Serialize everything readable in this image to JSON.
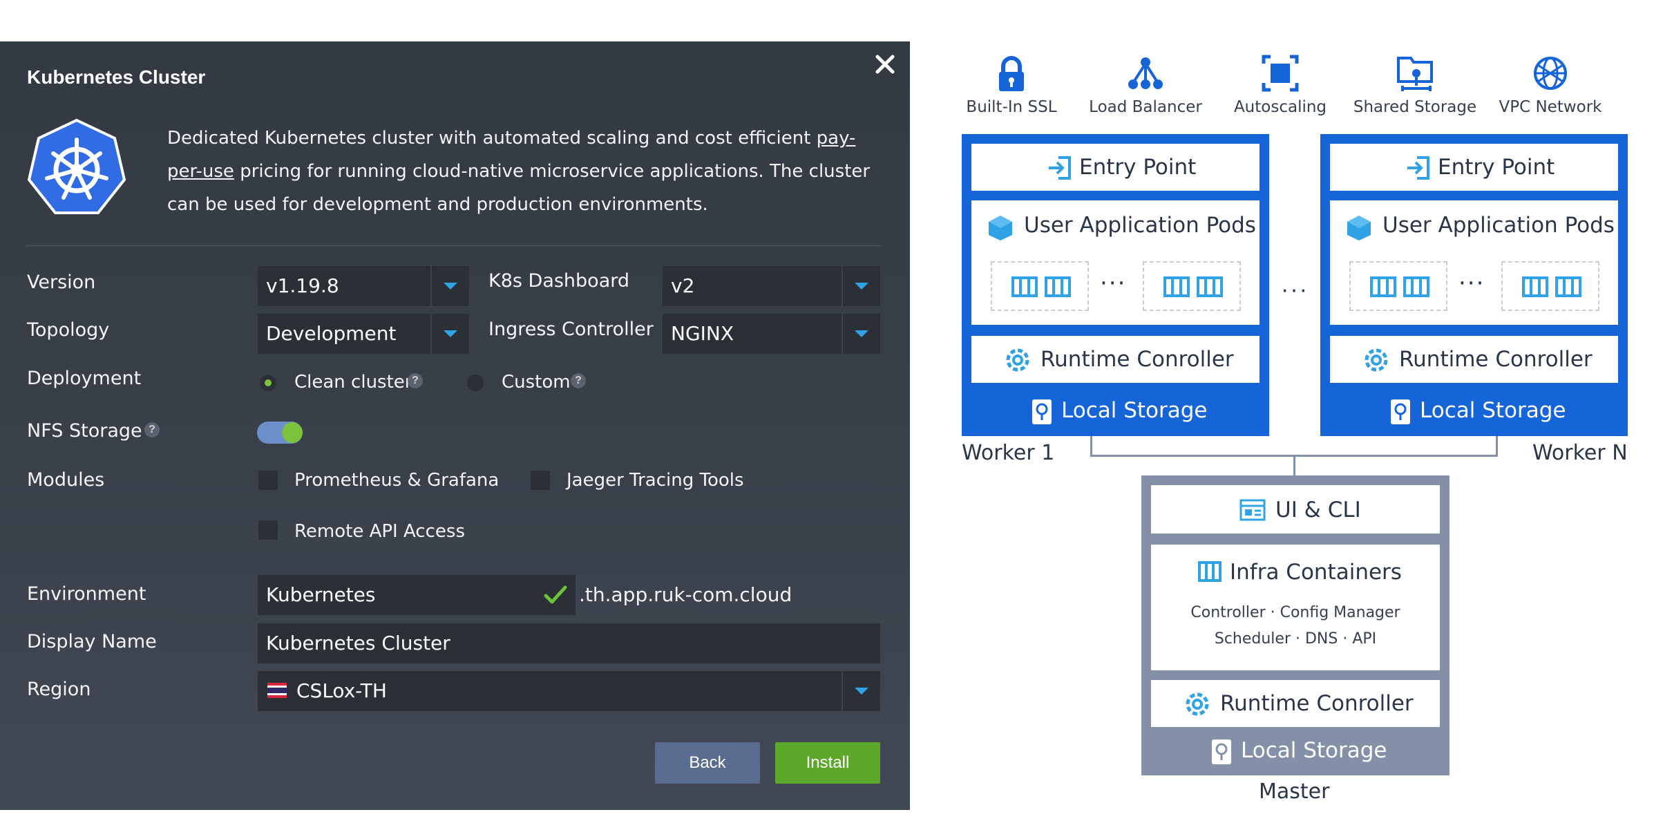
{
  "dialog": {
    "title": "Kubernetes Cluster",
    "description_part1": "Dedicated Kubernetes cluster with automated scaling and cost efficient ",
    "description_link": "pay-per-use",
    "description_part2": " pricing for running cloud-native microservice applications. The cluster can be used for development and production environments.",
    "version": {
      "label": "Version",
      "value": "v1.19.8"
    },
    "k8s_dashboard": {
      "label": "K8s Dashboard",
      "value": "v2"
    },
    "topology": {
      "label": "Topology",
      "value": "Development"
    },
    "ingress": {
      "label": "Ingress Controller",
      "value": "NGINX"
    },
    "deployment": {
      "label": "Deployment",
      "option1": "Clean cluster",
      "option2": "Custom",
      "selected": "Clean cluster"
    },
    "nfs": {
      "label": "NFS Storage",
      "enabled": true
    },
    "modules": {
      "label": "Modules",
      "items": [
        "Prometheus & Grafana",
        "Jaeger Tracing Tools",
        "Remote API Access"
      ]
    },
    "environment": {
      "label": "Environment",
      "value": "Kubernetes",
      "suffix": ".th.app.ruk-com.cloud"
    },
    "display_name": {
      "label": "Display Name",
      "value": "Kubernetes Cluster"
    },
    "region": {
      "label": "Region",
      "value": "CSLox-TH"
    },
    "buttons": {
      "back": "Back",
      "install": "Install"
    },
    "colors": {
      "accent": "#2fa3e6",
      "install": "#5da82b",
      "back": "#5a6c8f"
    }
  },
  "diagram": {
    "features": [
      "Built-In SSL",
      "Load Balancer",
      "Autoscaling",
      "Shared Storage",
      "VPC Network"
    ],
    "worker": {
      "entry_point": "Entry Point",
      "pods": "User Application Pods",
      "runtime": "Runtime Conroller",
      "storage": "Local Storage"
    },
    "worker1_label": "Worker 1",
    "workerN_label": "Worker N",
    "ellipsis": "···",
    "master": {
      "ui": "UI & CLI",
      "infra": "Infra Containers",
      "infra_line1": "Controller · Config Manager",
      "infra_line2": "Scheduler · DNS · API",
      "runtime": "Runtime Conroller",
      "storage": "Local Storage",
      "label": "Master"
    },
    "colors": {
      "worker": "#1565d8",
      "master": "#8390a8"
    }
  }
}
